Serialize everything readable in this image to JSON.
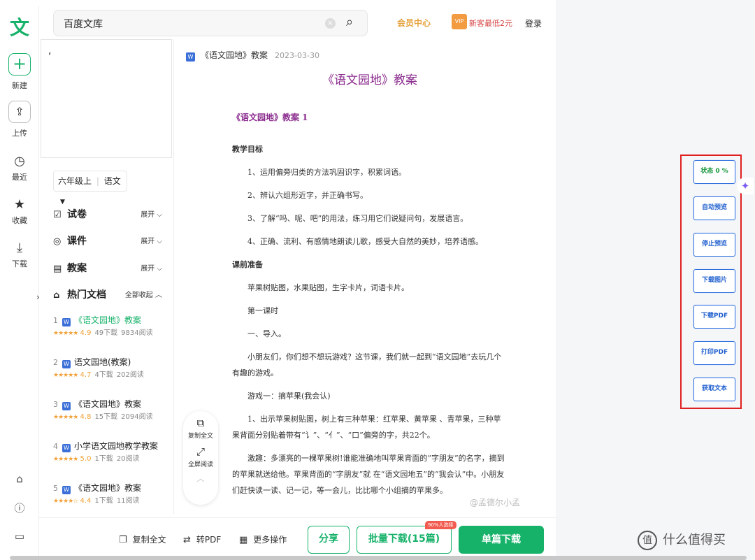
{
  "header": {
    "search_value": "百度文库",
    "vip_center": "会员中心",
    "vip_badge": "VIP",
    "vip_promo": "新客最低2元",
    "login": "登录"
  },
  "rail": {
    "logo": "文",
    "items": [
      {
        "label": "新建",
        "icon": "plus-icon"
      },
      {
        "label": "上传",
        "icon": "upload-icon"
      },
      {
        "label": "最近",
        "icon": "clock-icon"
      },
      {
        "label": "收藏",
        "icon": "star-icon"
      },
      {
        "label": "下载",
        "icon": "download-icon"
      }
    ],
    "bottom_icons": [
      "gift-icon",
      "help-icon",
      "desktop-icon"
    ]
  },
  "sidebar": {
    "thumbnail_text": ",",
    "grade": "六年级上",
    "subject": "语文",
    "categories": [
      {
        "label": "试卷",
        "action": "展开"
      },
      {
        "label": "课件",
        "action": "展开"
      },
      {
        "label": "教案",
        "action": "展开"
      },
      {
        "label": "热门文档",
        "action": "全部收起"
      }
    ],
    "hot_docs": [
      {
        "num": "1",
        "title": "《语文园地》教案",
        "score": "4.9",
        "downloads": "49下载",
        "reads": "9834阅读"
      },
      {
        "num": "2",
        "title": "语文园地(教案)",
        "score": "4.7",
        "downloads": "4下载",
        "reads": "202阅读"
      },
      {
        "num": "3",
        "title": "《语文园地》教案",
        "score": "4.8",
        "downloads": "15下载",
        "reads": "2094阅读"
      },
      {
        "num": "4",
        "title": "小学语文园地教学教案",
        "score": "5.0",
        "downloads": "1下载",
        "reads": "20阅读"
      },
      {
        "num": "5",
        "title": "《语文园地》教案",
        "score": "4.4",
        "downloads": "1下载",
        "reads": "11阅读"
      }
    ]
  },
  "document": {
    "file_name": "《语文园地》教案",
    "date": "2023-03-30",
    "title": "《语文园地》教案",
    "subtitle": "《语文园地》教案 1",
    "paragraphs": [
      {
        "text": "教学目标",
        "style": "bold"
      },
      {
        "text": "1、运用偏旁归类的方法巩固识字，积累词语。",
        "style": "ind"
      },
      {
        "text": "2、辨认六组形近字，并正确书写。",
        "style": "ind"
      },
      {
        "text": "3、了解“吗、呢、吧”的用法，练习用它们说疑问句，发展语言。",
        "style": "ind"
      },
      {
        "text": "4、正确、流利、有感情地朗读儿歌，感受大自然的美妙，培养语感。",
        "style": "ind"
      },
      {
        "text": "课前准备",
        "style": "bold"
      },
      {
        "text": "苹果树贴图，水果贴图，生字卡片，词语卡片。",
        "style": "ind"
      },
      {
        "text": "第一课时",
        "style": "ind"
      },
      {
        "text": "一、导入。",
        "style": "ind"
      },
      {
        "text": "小朋友们，你们想不想玩游戏？这节课，我们就一起到“语文园地”去玩几个有趣的游戏。",
        "style": "ind"
      },
      {
        "text": "游戏一：摘苹果(我会认)",
        "style": "ind"
      },
      {
        "text": "1、出示苹果树贴图，树上有三种苹果：红苹果、黄苹果 、青苹果，三种苹果背面分别贴着带有“讠”、“亻”、“口”偏旁的字，共22个。",
        "style": "ind"
      },
      {
        "text": "激趣：多漂亮的一棵苹果树!谁能准确地叫苹果背面的“字朋友”的名字，摘到的苹果就送给他。苹果背面的“字朋友”就 在“语文园地五”的“我会认”中。小朋友们赶快读一读、记一记，等一会儿，比比哪个小组摘的苹果多。",
        "style": "ind"
      }
    ]
  },
  "floater": {
    "copy": "复制全文",
    "fullscreen": "全屏阅读"
  },
  "watermark": "@孟德尔小孟",
  "bottombar": {
    "copy": "复制全文",
    "to_pdf": "转PDF",
    "more": "更多操作",
    "share": "分享",
    "batch_download": "批量下载(15篇)",
    "hot_tag": "90%人选择",
    "single_download": "单篇下载"
  },
  "tools": {
    "status": "状态 0 %",
    "auto_preview": "自动预览",
    "stop_preview": "停止预览",
    "download_images": "下载图片",
    "download_pdf": "下载PDF",
    "print_pdf": "打印PDF",
    "get_text": "获取文本"
  },
  "brand": {
    "icon_char": "值",
    "name": "什么值得买"
  }
}
